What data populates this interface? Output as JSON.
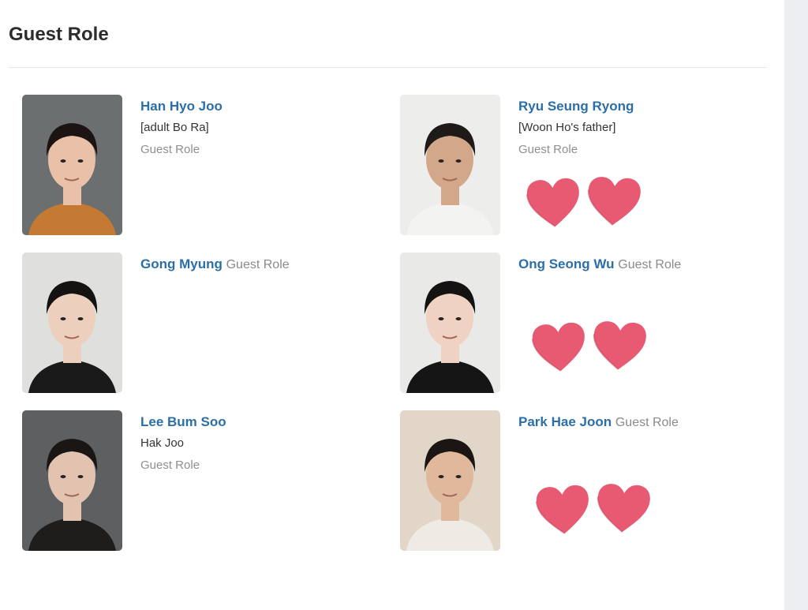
{
  "section": {
    "title": "Guest Role"
  },
  "colors": {
    "link": "#2b6fa6",
    "heart": "#e85a72"
  },
  "cast": [
    {
      "name": "Han Hyo Joo",
      "character": "[adult Bo Ra]",
      "role": "Guest Role",
      "photo_bg": "#6b6f70",
      "hair": "#1c1412",
      "skin": "#e9c0a8",
      "shirt": "#c57a34",
      "hearts": 0
    },
    {
      "name": "Ryu Seung Ryong",
      "character": "[Woon Ho's father]",
      "role": "Guest Role",
      "photo_bg": "#ededec",
      "hair": "#1e1a18",
      "skin": "#d3a88a",
      "shirt": "#f3f3f1",
      "hearts": 2
    },
    {
      "name": "Gong Myung",
      "character": "",
      "role": "Guest Role",
      "photo_bg": "#dfe0dd",
      "hair": "#151312",
      "skin": "#ecd0bd",
      "shirt": "#1a1a1a",
      "hearts": 0
    },
    {
      "name": "Ong Seong Wu",
      "character": "",
      "role": "Guest Role",
      "photo_bg": "#e9e9e8",
      "hair": "#141212",
      "skin": "#efd2c1",
      "shirt": "#151515",
      "hearts": 2
    },
    {
      "name": "Lee Bum Soo",
      "character": "Hak Joo",
      "role": "Guest Role",
      "photo_bg": "#5d5f60",
      "hair": "#1a1614",
      "skin": "#e2c3b0",
      "shirt": "#1f1c1c",
      "hearts": 0
    },
    {
      "name": "Park Hae Joon",
      "character": "",
      "role": "Guest Role",
      "photo_bg": "#e2d6c8",
      "hair": "#1b1614",
      "skin": "#e0b89b",
      "shirt": "#eeeae4",
      "hearts": 2
    }
  ]
}
